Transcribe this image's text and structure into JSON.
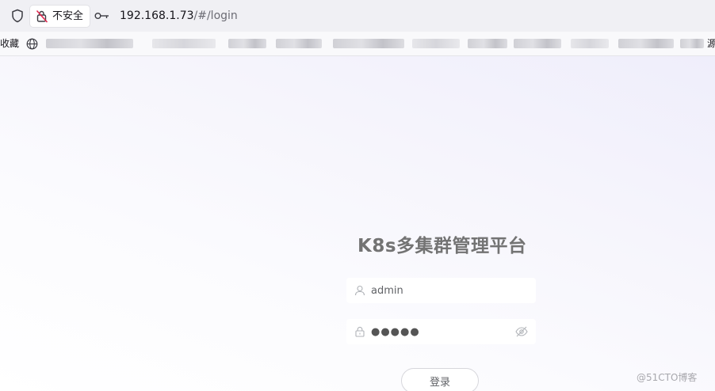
{
  "browser": {
    "security_label": "不安全",
    "url_host": "192.168.1.73",
    "url_path": "/#/login"
  },
  "bookmarks": {
    "left_fragment": "收藏",
    "right_fragment": "源"
  },
  "login": {
    "title": "K8s多集群管理平台",
    "username_value": "admin",
    "password_value": "●●●●●",
    "submit_label": "登录"
  },
  "watermark": "@51CTO博客",
  "colors": {
    "title": "#737373",
    "background_tint": "#efeefb"
  }
}
